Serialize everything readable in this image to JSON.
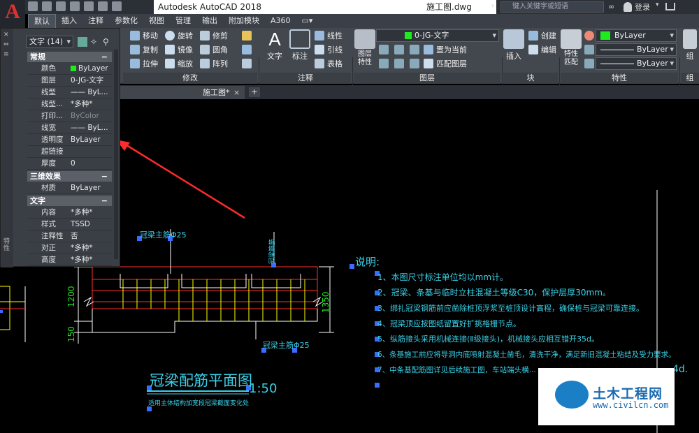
{
  "titlebar": {
    "app_title": "Autodesk AutoCAD 2018",
    "doc_title": "施工图.dwg",
    "search_placeholder": "键入关键字或短语",
    "login": "登录"
  },
  "ribbon_tabs": [
    "默认",
    "插入",
    "注释",
    "参数化",
    "视图",
    "管理",
    "输出",
    "附加模块",
    "A360"
  ],
  "ribbon": {
    "modify": {
      "items": [
        "移动",
        "旋转",
        "修剪",
        "复制",
        "镜像",
        "圆角",
        "拉伸",
        "缩放",
        "阵列"
      ],
      "label": "修改"
    },
    "annotation": {
      "text": "文字",
      "dim": "标注",
      "linear": "线性",
      "leader": "引线",
      "table": "表格",
      "label": "注释"
    },
    "layers": {
      "layer_props": "图层特性",
      "current_layer": "0-JG-文字",
      "set_current": "置为当前",
      "match_layer": "匹配图层",
      "label": "图层"
    },
    "block": {
      "insert": "插入",
      "create": "创建",
      "edit": "编辑",
      "label": "块"
    },
    "properties": {
      "match": "特性匹配",
      "color": "ByLayer",
      "linetype": "ByLayer",
      "lineweight": "ByLayer",
      "label": "特性"
    },
    "groups": {
      "group": "组",
      "label": "组"
    }
  },
  "doc_tab": {
    "title": "施工图*"
  },
  "properties_palette": {
    "selection": "文字 (14)",
    "strip_title": "特性",
    "sections": [
      {
        "title": "常规",
        "rows": [
          {
            "name": "颜色",
            "value": "ByLayer"
          },
          {
            "name": "图层",
            "value": "0-JG-文字"
          },
          {
            "name": "线型",
            "value": "—— ByL..."
          },
          {
            "name": "线型...",
            "value": "*多种*"
          },
          {
            "name": "打印...",
            "value": "ByColor"
          },
          {
            "name": "线宽",
            "value": "—— ByL..."
          },
          {
            "name": "透明度",
            "value": "ByLayer"
          },
          {
            "name": "超链接",
            "value": ""
          },
          {
            "name": "厚度",
            "value": "0"
          }
        ]
      },
      {
        "title": "三维效果",
        "rows": [
          {
            "name": "材质",
            "value": "ByLayer"
          }
        ]
      },
      {
        "title": "文字",
        "rows": [
          {
            "name": "内容",
            "value": "*多种*"
          },
          {
            "name": "样式",
            "value": "TSSD"
          },
          {
            "name": "注释性",
            "value": "否"
          },
          {
            "name": "对正",
            "value": "*多种*"
          },
          {
            "name": "高度",
            "value": "*多种*"
          }
        ]
      }
    ],
    "toggle": "−"
  },
  "drawing": {
    "title": "冠梁配筋平面图",
    "scale": "1:50",
    "subtitle": "适用主体结构加宽段冠梁截面变化处",
    "dims": {
      "d1200": "1200",
      "d150": "150",
      "d1350": "1350"
    },
    "tag_top": "冠梁主筋Φ25",
    "tag_vert": "冠梁箍筋",
    "tag_bottom": "冠梁主筋Φ25",
    "notes_title": "说明:",
    "notes": [
      "1、本图尺寸标注单位均以mm计。",
      "2、冠梁、条基与临时立柱混凝土等级C30，保护层厚30mm。",
      "3、绑扎冠梁钢筋前应凿除桩顶浮浆至桩顶设计高程，确保桩与冠梁可靠连接。",
      "4、冠梁顶应按图纸留置好扩挑格栅节点。",
      "5、纵筋接头采用机械连接(Ⅱ级接头)，机械接头应相互错开35d。",
      "6、条基施工前应将导洞内底喷射混凝土凿毛，清洗干净，满足新旧混凝土粘结及受力要求。",
      "7、中条基配筋图详见后续施工图，车站端头横..."
    ],
    "note_tail": "4d."
  },
  "watermark": {
    "text": "土木工程网",
    "url": "www.civilcn.com"
  },
  "colors": {
    "cyan": "#3ad1e8",
    "yellow": "#ffff00",
    "red": "#ff3030",
    "green": "#1eea1e",
    "white": "#ffffff"
  }
}
